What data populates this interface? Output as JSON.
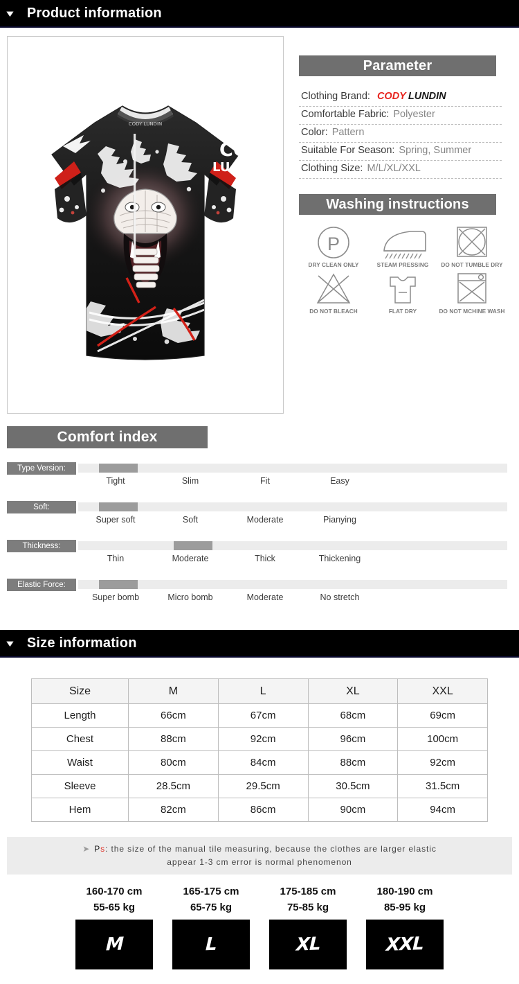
{
  "sections": {
    "product_information": {
      "title": "Product information",
      "caret": "▼"
    },
    "size_information": {
      "title": "Size information",
      "caret": "▼"
    }
  },
  "product_image": {
    "alt": "black cobra print short sleeve compression shirt",
    "sleeve_text_1": "CO",
    "sleeve_text_2": "LU"
  },
  "parameter": {
    "title": "Parameter",
    "rows": [
      {
        "label": "Clothing Brand:",
        "value_red": "CODY",
        "value_black": "LUNDIN"
      },
      {
        "label": "Comfortable Fabric:",
        "value": "Polyester"
      },
      {
        "label": "Color:",
        "value": "Pattern"
      },
      {
        "label": "Suitable For Season:",
        "value": "Spring, Summer"
      },
      {
        "label": "Clothing Size:",
        "value": "M/L/XL/XXL"
      }
    ]
  },
  "washing": {
    "title": "Washing instructions",
    "icons": [
      {
        "name": "dry-clean-only-icon",
        "caption": "DRY CLEAN ONLY"
      },
      {
        "name": "steam-pressing-icon",
        "caption": "STEAM PRESSING"
      },
      {
        "name": "do-not-tumble-dry-icon",
        "caption": "DO NOT TUMBLE DRY"
      },
      {
        "name": "do-not-bleach-icon",
        "caption": "DO NOT BLEACH"
      },
      {
        "name": "flat-dry-icon",
        "caption": "FLAT DRY"
      },
      {
        "name": "do-not-machine-wash-icon",
        "caption": "DO NOT MCHINE WASH"
      }
    ]
  },
  "comfort_index": {
    "title": "Comfort index",
    "rows": [
      {
        "tag": "Type Version:",
        "options": [
          "Tight",
          "Slim",
          "Fit",
          "Easy"
        ],
        "selected_index": 0
      },
      {
        "tag": "Soft:",
        "options": [
          "Super soft",
          "Soft",
          "Moderate",
          "Pianying"
        ],
        "selected_index": 0
      },
      {
        "tag": "Thickness:",
        "options": [
          "Thin",
          "Moderate",
          "Thick",
          "Thickening"
        ],
        "selected_index": 1
      },
      {
        "tag": "Elastic Force:",
        "options": [
          "Super bomb",
          "Micro bomb",
          "Moderate",
          "No stretch"
        ],
        "selected_index": 0
      }
    ]
  },
  "size_table": {
    "headers": [
      "Size",
      "M",
      "L",
      "XL",
      "XXL"
    ],
    "rows": [
      {
        "label": "Length",
        "values": [
          "66cm",
          "67cm",
          "68cm",
          "69cm"
        ]
      },
      {
        "label": "Chest",
        "values": [
          "88cm",
          "92cm",
          "96cm",
          "100cm"
        ]
      },
      {
        "label": "Waist",
        "values": [
          "80cm",
          "84cm",
          "88cm",
          "92cm"
        ]
      },
      {
        "label": "Sleeve",
        "values": [
          "28.5cm",
          "29.5cm",
          "30.5cm",
          "31.5cm"
        ]
      },
      {
        "label": "Hem",
        "values": [
          "82cm",
          "86cm",
          "90cm",
          "94cm"
        ]
      }
    ]
  },
  "ps_note": {
    "arrow": "➤",
    "prefix_dark": "P",
    "prefix_red": "s",
    "line1": ": the size of the manual tile measuring, because the clothes are larger elastic",
    "line2": "appear 1-3 cm error is normal phenomenon"
  },
  "size_cards": [
    {
      "height": "160-170 cm",
      "weight": "55-65 kg",
      "letter": "M"
    },
    {
      "height": "165-175 cm",
      "weight": "65-75 kg",
      "letter": "L"
    },
    {
      "height": "175-185 cm",
      "weight": "75-85 kg",
      "letter": "XL"
    },
    {
      "height": "180-190 cm",
      "weight": "85-95 kg",
      "letter": "XXL"
    }
  ],
  "colors": {
    "banner_bg": "#000000",
    "plaque_bg": "#6f6f6f",
    "tag_bg": "#7d7d7d",
    "track_bg": "#ececec",
    "marker_bg": "#9c9c9c",
    "accent_red": "#e8251f",
    "note_bg": "#ececec"
  }
}
